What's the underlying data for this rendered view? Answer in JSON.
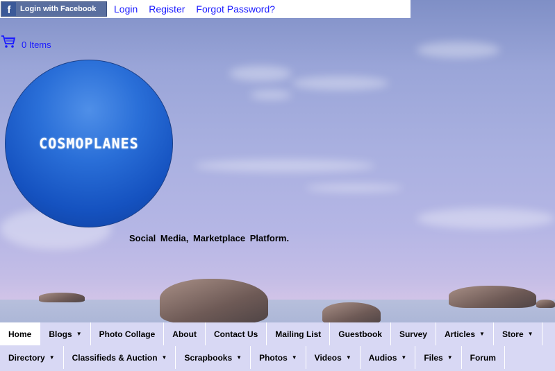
{
  "topbar": {
    "facebook_label": "Login with Facebook",
    "links": [
      "Login",
      "Register",
      "Forgot Password?"
    ]
  },
  "cart": {
    "label": "0 Items",
    "icon": "cart-icon"
  },
  "logo": {
    "text": "COSMOPLANES"
  },
  "tagline": "Social  Media, Marketplace  Platform.",
  "nav": {
    "row1": [
      {
        "label": "Home",
        "dropdown": false,
        "active": true
      },
      {
        "label": "Blogs",
        "dropdown": true
      },
      {
        "label": "Photo Collage",
        "dropdown": false
      },
      {
        "label": "About",
        "dropdown": false
      },
      {
        "label": "Contact Us",
        "dropdown": false
      },
      {
        "label": "Mailing List",
        "dropdown": false
      },
      {
        "label": "Guestbook",
        "dropdown": false
      },
      {
        "label": "Survey",
        "dropdown": false
      },
      {
        "label": "Articles",
        "dropdown": true
      },
      {
        "label": "Store",
        "dropdown": true
      }
    ],
    "row2": [
      {
        "label": "Directory",
        "dropdown": true
      },
      {
        "label": "Classifieds & Auction",
        "dropdown": true
      },
      {
        "label": "Scrapbooks",
        "dropdown": true
      },
      {
        "label": "Photos",
        "dropdown": true
      },
      {
        "label": "Videos",
        "dropdown": true
      },
      {
        "label": "Audios",
        "dropdown": true
      },
      {
        "label": "Files",
        "dropdown": true
      },
      {
        "label": "Forum",
        "dropdown": false
      }
    ]
  },
  "colors": {
    "link": "#1a1aff",
    "nav_bg": "#d8d8f4",
    "facebook": "#3b5998"
  }
}
